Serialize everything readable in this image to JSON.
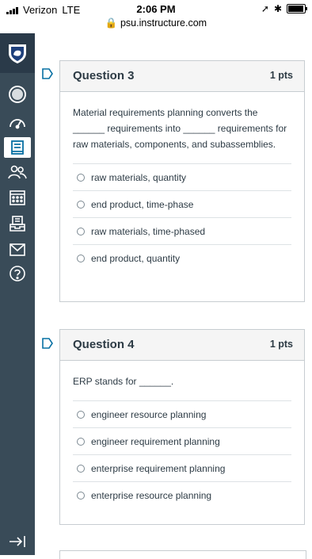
{
  "status_bar": {
    "carrier": "Verizon",
    "network": "LTE",
    "time": "2:06 PM",
    "url": "psu.instructure.com"
  },
  "sidebar": {
    "items": [
      {
        "name": "logo-icon"
      },
      {
        "name": "account-icon"
      },
      {
        "name": "dashboard-icon"
      },
      {
        "name": "courses-icon"
      },
      {
        "name": "groups-icon"
      },
      {
        "name": "calendar-icon"
      },
      {
        "name": "inbox-tray-icon"
      },
      {
        "name": "mail-icon"
      },
      {
        "name": "help-icon"
      }
    ]
  },
  "questions": [
    {
      "title": "Question 3",
      "points": "1 pts",
      "text": "Material requirements planning converts the ______ requirements into ______ requirements for raw materials, components, and subassemblies.",
      "answers": [
        "raw materials, quantity",
        "end product, time-phase",
        "raw materials, time-phased",
        "end product, quantity"
      ]
    },
    {
      "title": "Question 4",
      "points": "1 pts",
      "text": "ERP stands for ______.",
      "answers": [
        "engineer resource planning",
        "engineer requirement planning",
        "enterprise requirement planning",
        "enterprise resource planning"
      ]
    }
  ],
  "colors": {
    "sidebar": "#394b58",
    "accent": "#0770a3"
  }
}
